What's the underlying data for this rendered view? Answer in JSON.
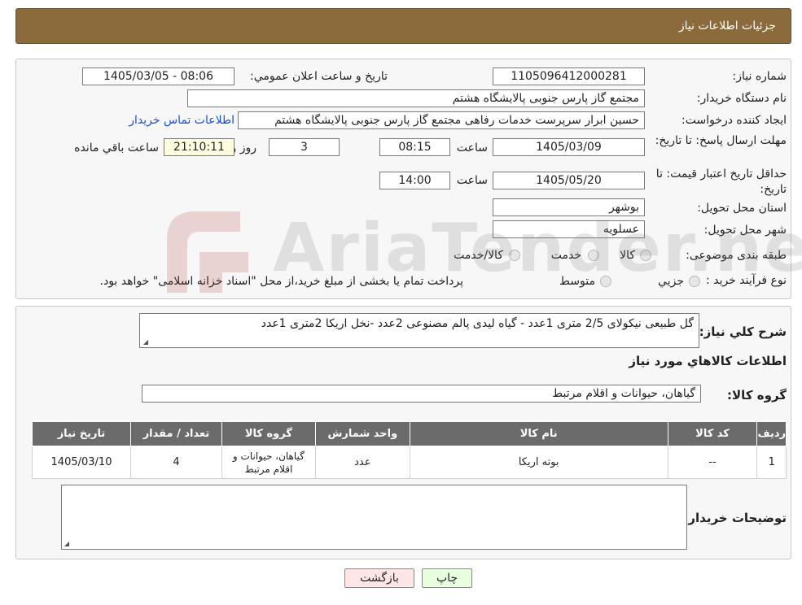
{
  "header": {
    "title": "جزئیات اطلاعات نیاز"
  },
  "form": {
    "need_number_label": "شماره نیاز:",
    "need_number": "1105096412000281",
    "announce_label": "تاریخ و ساعت اعلان عمومي:",
    "announce_value": "1405/03/05 - 08:06",
    "buyer_label": "نام دستگاه خريدار:",
    "buyer_value": "مجتمع گاز پارس جنوبی  پالایشگاه هشتم",
    "creator_label": "ايجاد کننده درخواست:",
    "creator_value": "حسین ابرار سرپرست خدمات رفاهی مجتمع گاز پارس جنوبی  پالایشگاه هشتم",
    "contact_link": "اطلاعات تماس خريدار",
    "deadline_label": "مهلت ارسال پاسخ: تا تاريخ:",
    "deadline_date": "1405/03/09",
    "time_label": "ساعت",
    "deadline_time": "08:15",
    "days_value": "3",
    "days_label": "روز و",
    "remaining_time": "21:10:11",
    "remaining_label": "ساعت باقي مانده",
    "validity_label": "حداقل تاريخ اعتبار قيمت: تا تاريخ:",
    "validity_date": "1405/05/20",
    "validity_time": "14:00",
    "province_label": "استان محل تحويل:",
    "province_value": "بوشهر",
    "city_label": "شهر محل تحويل:",
    "city_value": "عسلويه",
    "category_label": "طبقه بندی موضوعی:",
    "category_options": [
      "کالا",
      "خدمت",
      "کالا/خدمت"
    ],
    "process_label": "نوع فرآيند خريد :",
    "process_options": [
      "جزيي",
      "متوسط"
    ],
    "process_note": "پرداخت تمام يا بخشی از مبلغ خريد،از محل \"اسناد خزانه اسلامی\" خواهد بود."
  },
  "details": {
    "desc_label": "شرح کلي نياز:",
    "desc_value": "گل طبیعی نیکولای 2/5 متری 1عدد - گیاه لیدی پالم مصنوعی 2عدد -نخل اریکا 2متری 1عدد",
    "items_heading": "اطلاعات کالاهاي مورد نياز",
    "group_label": "گروه کالا:",
    "group_value": "گیاهان، حیوانات و اقلام مرتبط"
  },
  "table": {
    "headers": [
      "رديف",
      "کد کالا",
      "نام کالا",
      "واحد شمارش",
      "گروه کالا",
      "تعداد / مقدار",
      "تاريخ نياز"
    ],
    "rows": [
      [
        "1",
        "--",
        "بوته اریکا",
        "عدد",
        "گیاهان، حیوانات و اقلام مرتبط",
        "4",
        "1405/03/10"
      ]
    ]
  },
  "notes": {
    "label": "توضيحات خريدار:",
    "value": ""
  },
  "buttons": {
    "print": "چاپ",
    "back": "بازگشت"
  },
  "watermark": {
    "text": "AriaTender.neT"
  },
  "colors": {
    "header_bg": "#8b6a3b",
    "table_header_bg": "#6b6b6b",
    "link": "#1a4fd6",
    "print_btn": "#e8ffe0",
    "back_btn": "#ffe6e6"
  }
}
